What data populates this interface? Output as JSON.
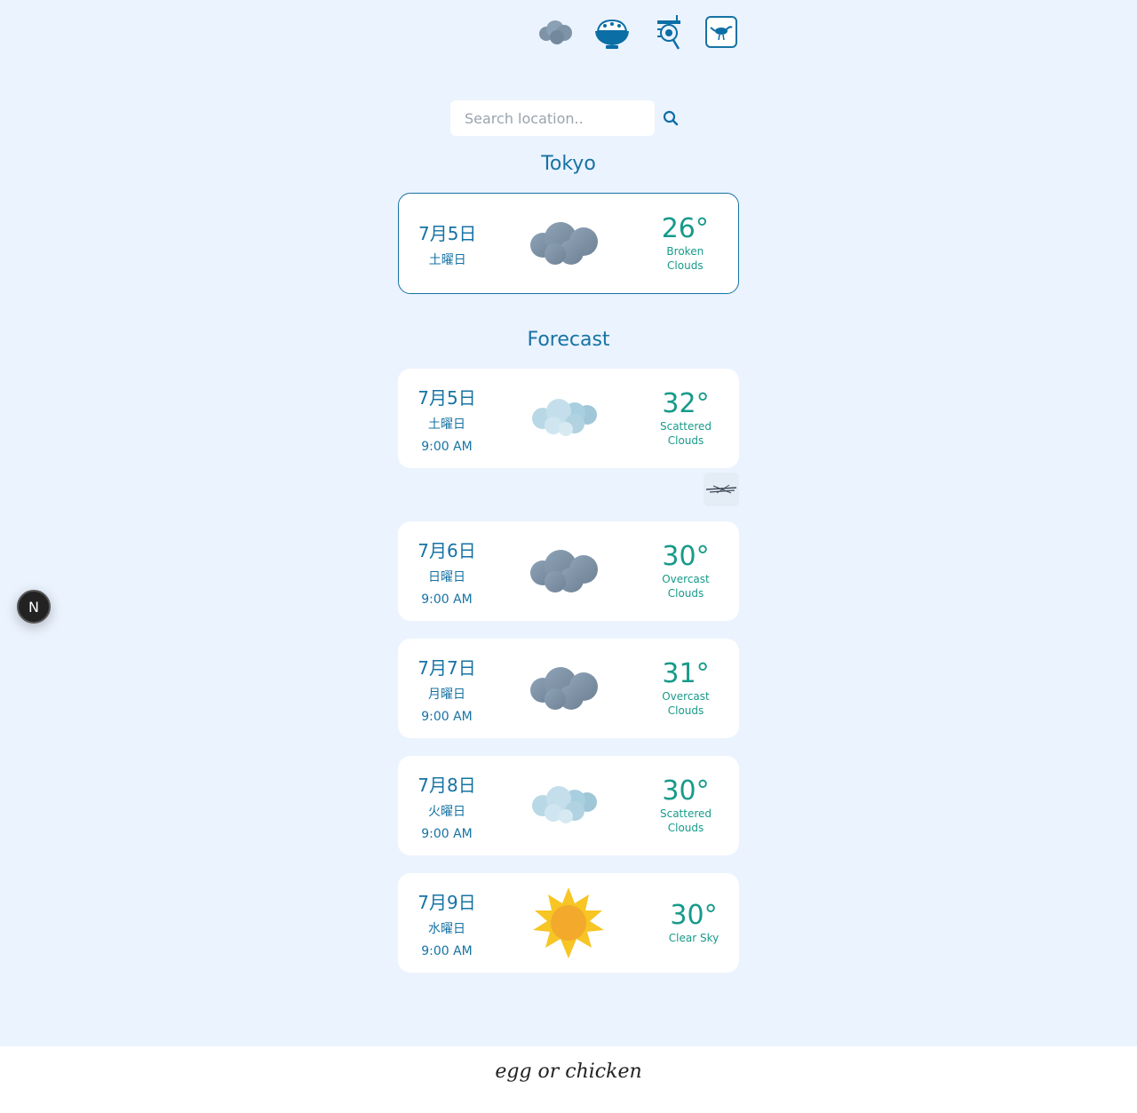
{
  "top_nav": {
    "icons": [
      {
        "name": "cloud-app-icon"
      },
      {
        "name": "rice-bowl-icon"
      },
      {
        "name": "camera-tool-icon"
      },
      {
        "name": "bird-icon"
      }
    ]
  },
  "search": {
    "placeholder": "Search location..",
    "value": ""
  },
  "location": {
    "city": "Tokyo"
  },
  "current": {
    "date": "7月5日",
    "weekday": "土曜日",
    "temp": "26°",
    "description_line1": "Broken",
    "description_line2": "Clouds",
    "icon": "broken-clouds-icon"
  },
  "forecast": {
    "title": "Forecast",
    "items": [
      {
        "date": "7月5日",
        "weekday": "土曜日",
        "time": "9:00 AM",
        "temp": "32°",
        "desc1": "Scattered",
        "desc2": "Clouds",
        "icon": "scattered-clouds-icon"
      },
      {
        "date": "7月6日",
        "weekday": "日曜日",
        "time": "9:00 AM",
        "temp": "30°",
        "desc1": "Overcast",
        "desc2": "Clouds",
        "icon": "overcast-clouds-icon"
      },
      {
        "date": "7月7日",
        "weekday": "月曜日",
        "time": "9:00 AM",
        "temp": "31°",
        "desc1": "Overcast",
        "desc2": "Clouds",
        "icon": "overcast-clouds-icon"
      },
      {
        "date": "7月8日",
        "weekday": "火曜日",
        "time": "9:00 AM",
        "temp": "30°",
        "desc1": "Scattered",
        "desc2": "Clouds",
        "icon": "scattered-clouds-icon"
      },
      {
        "date": "7月9日",
        "weekday": "水曜日",
        "time": "9:00 AM",
        "temp": "30°",
        "desc1": "Clear Sky",
        "desc2": "",
        "icon": "clear-sky-icon"
      }
    ]
  },
  "dev_badge": {
    "label": "N"
  },
  "footer": {
    "brand": "egg or chicken"
  },
  "colors": {
    "background": "#ebf3fe",
    "primary": "#1673a4",
    "temp": "#179a8a",
    "card": "#ffffff"
  }
}
